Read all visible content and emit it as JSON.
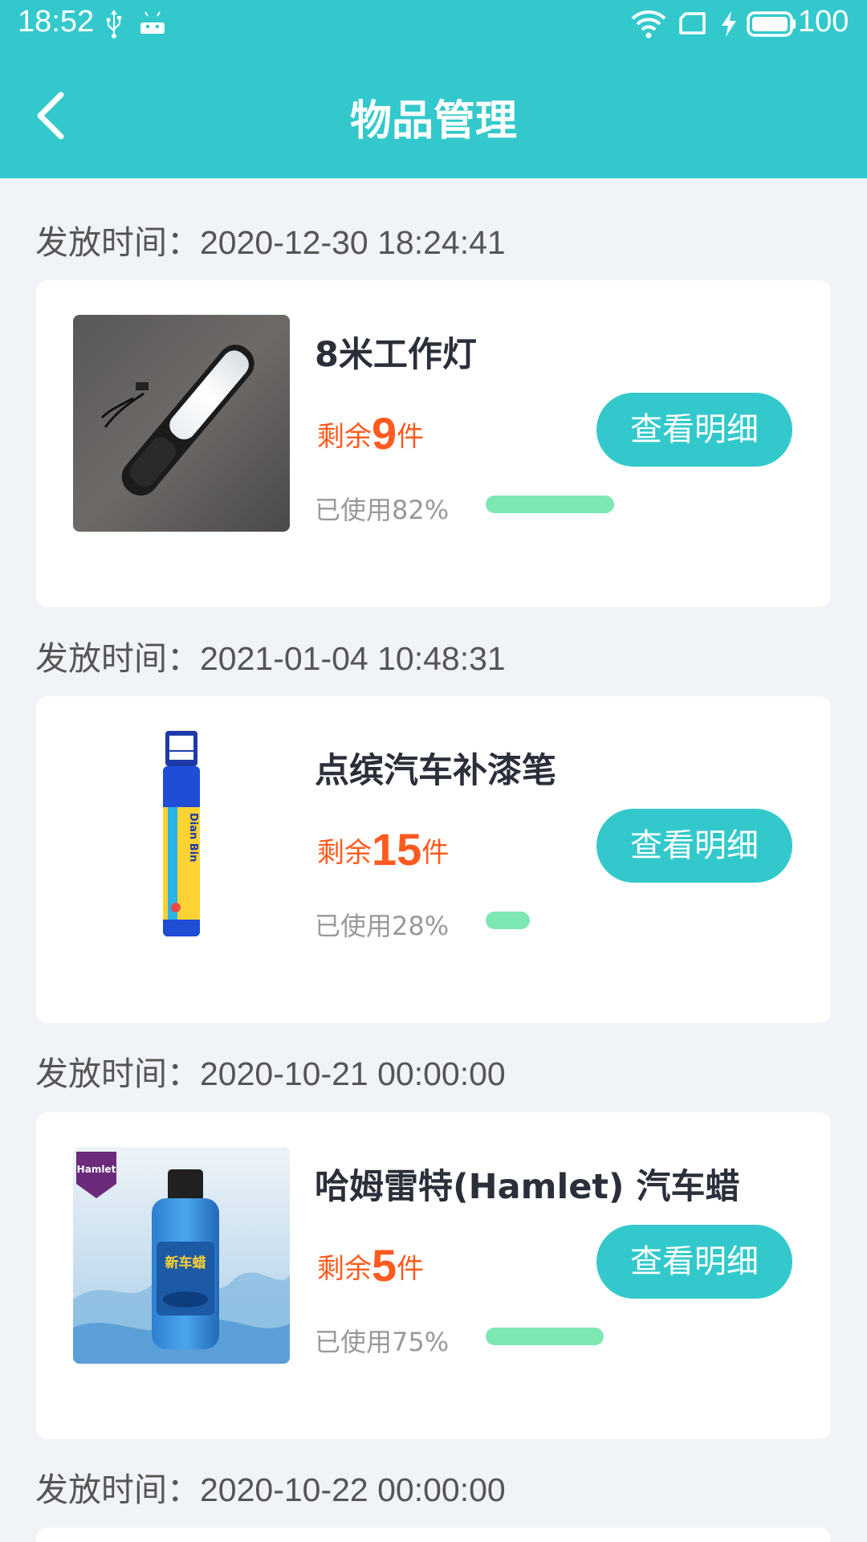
{
  "status_bar": {
    "time": "18:52",
    "battery_percent": "100"
  },
  "header": {
    "title": "物品管理"
  },
  "colors": {
    "primary": "#33c9cc",
    "remain_text": "#ff5a1f",
    "progress": "#7de8b2"
  },
  "items": [
    {
      "date_label": "发放时间：",
      "date": "2020-12-30 18:24:41",
      "name": "8米工作灯",
      "remain_prefix": "剩余",
      "remain_count": "9",
      "remain_unit": "件",
      "used_text": "已使用82%",
      "used_fraction": 0.82,
      "button_label": "查看明细"
    },
    {
      "date_label": "发放时间：",
      "date": "2021-01-04 10:48:31",
      "name": "点缤汽车补漆笔",
      "remain_prefix": "剩余",
      "remain_count": "15",
      "remain_unit": "件",
      "used_text": "已使用28%",
      "used_fraction": 0.28,
      "button_label": "查看明细",
      "thumb_text": "Dian Bin"
    },
    {
      "date_label": "发放时间：",
      "date": "2020-10-21 00:00:00",
      "name": "哈姆雷特(Hamlet) 汽车蜡",
      "remain_prefix": "剩余",
      "remain_count": "5",
      "remain_unit": "件",
      "used_text": "已使用75%",
      "used_fraction": 0.75,
      "button_label": "查看明细",
      "thumb_text": "Hamlet",
      "thumb_bottle_text": "新车蜡"
    },
    {
      "date_label": "发放时间：",
      "date": "2020-10-22 00:00:00"
    }
  ]
}
